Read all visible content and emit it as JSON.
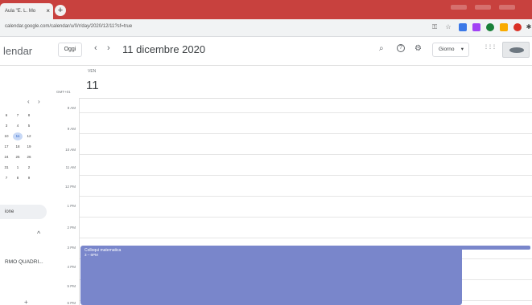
{
  "browser": {
    "tab_title": "Aula \"E. L. Mo",
    "tab_close": "×",
    "new_tab": "+",
    "url": "calendar.google.com/calendar/u/0/r/day/2020/12/11?sf=true",
    "icons": [
      "key-icon",
      "star-icon",
      "extension-icon",
      "extension-icon",
      "extension-icon",
      "extension-icon",
      "extension-icon",
      "puzzle-icon"
    ],
    "colors": {
      "tab_strip": "#c8413e",
      "accent": "#1a73e8",
      "event": "#7986cb"
    }
  },
  "header": {
    "app_name": "lendar",
    "today_label": "Oggi",
    "prev_label": "‹",
    "next_label": "›",
    "date_title": "11 dicembre 2020",
    "search_icon": "⌕",
    "help_icon": "?",
    "settings_icon": "⚙",
    "view_label": "Giorno",
    "view_caret": "▾",
    "apps_icon": "⋮⋮⋮"
  },
  "mini_calendar": {
    "prev": "‹",
    "next": "›",
    "rows": [
      [
        "6",
        "7",
        "8"
      ],
      [
        "3",
        "4",
        "5"
      ],
      [
        "10",
        "11",
        "12"
      ],
      [
        "17",
        "18",
        "19"
      ],
      [
        "24",
        "25",
        "26"
      ],
      [
        "31",
        "1",
        "2"
      ],
      [
        "7",
        "8",
        "9"
      ]
    ],
    "today": "11"
  },
  "sidebar": {
    "item_label": "ione",
    "caret": "^",
    "calendar_label": "RMO QUADRI...",
    "plus": "+"
  },
  "day": {
    "weekday": "VEN",
    "number": "11",
    "timezone": "GMT+01",
    "hours": [
      "8 AM",
      "9 AM",
      "10 AM",
      "11 AM",
      "12 PM",
      "1 PM",
      "2 PM",
      "3 PM",
      "4 PM",
      "5 PM",
      "6 PM"
    ]
  },
  "events": {
    "main_title": "Colloqui matematica",
    "main_time": "3 – 6PM",
    "bar_title": "Colloqui matematica"
  }
}
